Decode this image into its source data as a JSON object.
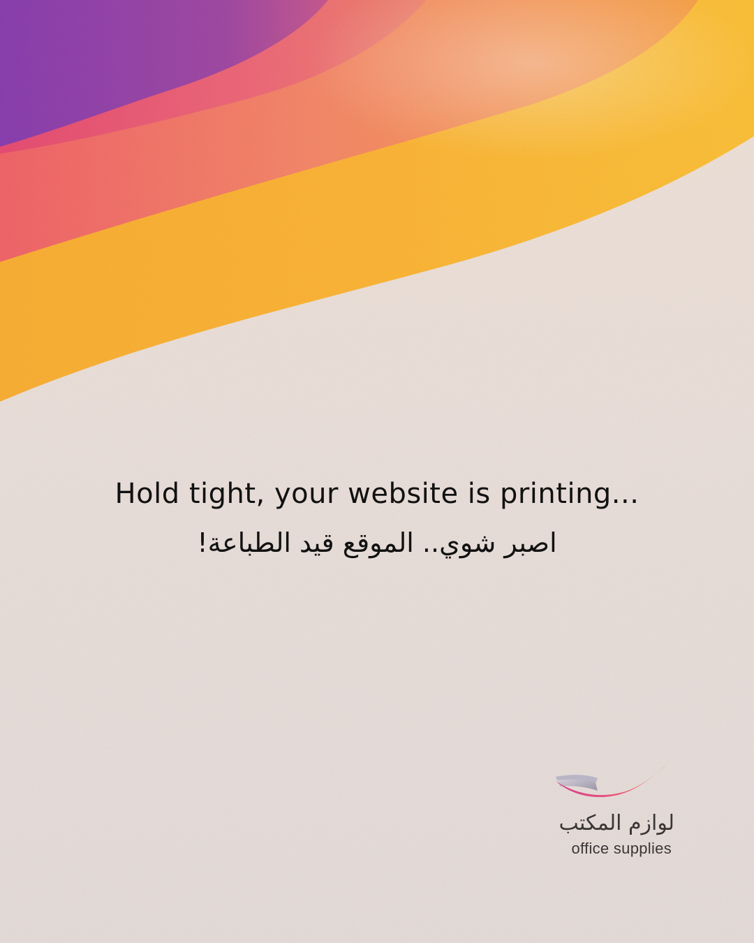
{
  "headline": {
    "english": "Hold tight, your website is printing...",
    "arabic": "اصبر شوي.. الموقع قيد الطباعة!"
  },
  "logo": {
    "arabic_name": "لوازم المكتب",
    "english_name": "office supplies",
    "icon": "paper-swoosh-icon"
  },
  "colors": {
    "background": "#ebe2dc",
    "wave_purple": "#8a3fb0",
    "wave_pink": "#e8527a",
    "wave_coral": "#f2836a",
    "wave_amber": "#f9a938",
    "wave_yellow": "#fdbd35",
    "text": "#111111",
    "logo_text": "#3b3636",
    "logo_pink": "#e0457f",
    "logo_orange": "#f7a063"
  }
}
